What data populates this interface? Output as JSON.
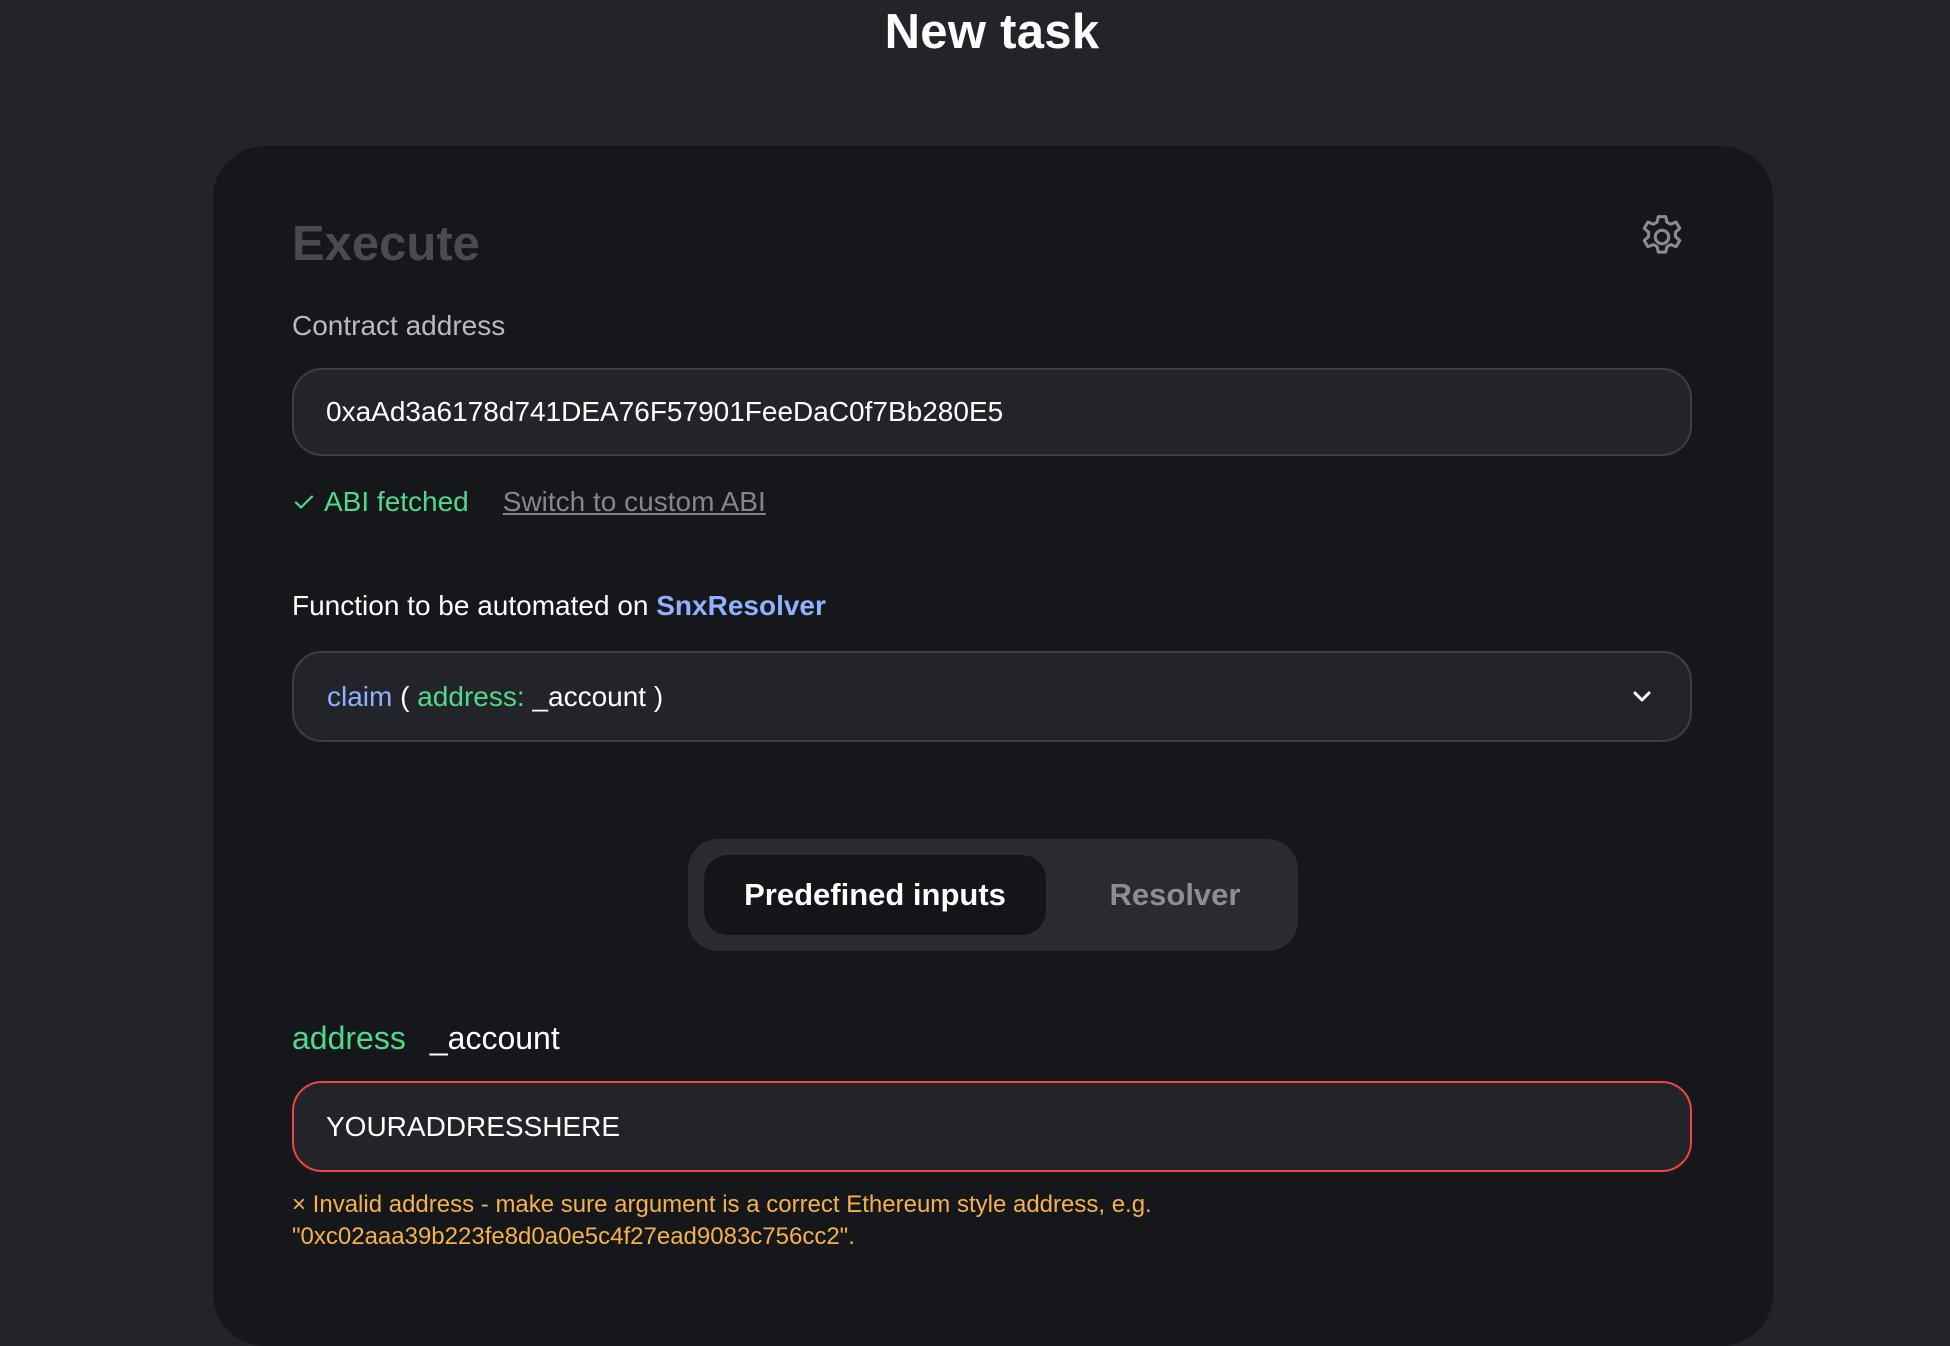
{
  "page": {
    "title": "New task"
  },
  "card": {
    "title": "Execute",
    "settings_icon": "gear-icon"
  },
  "contract": {
    "label": "Contract address",
    "value": "0xaAd3a6178d741DEA76F57901FeeDaC0f7Bb280E5"
  },
  "abi": {
    "status_icon": "check-icon",
    "status": "ABI fetched",
    "switch_link": "Switch to custom ABI"
  },
  "function_select": {
    "label_prefix": "Function to be automated on",
    "contract_name": "SnxResolver",
    "selected": {
      "name": "claim",
      "open_paren": "(",
      "param_type": "address:",
      "param_name": "_account",
      "close_paren": ")"
    },
    "dropdown_icon": "chevron-down-icon"
  },
  "mode_toggle": {
    "options": [
      {
        "label": "Predefined inputs",
        "active": true
      },
      {
        "label": "Resolver",
        "active": false
      }
    ]
  },
  "argument": {
    "type": "address",
    "name": "_account",
    "value": "YOURADDRESSHERE",
    "error_line1": "× Invalid address - make sure argument is a correct Ethereum style address, e.g.",
    "error_line2": "\"0xc02aaa39b223fe8d0a0e5c4f27ead9083c756cc2\"."
  },
  "colors": {
    "background": "#25222a",
    "card": "#16171b",
    "accent_blue": "#8fb1ff",
    "accent_green": "#4fd98a",
    "error_border": "#ef4444",
    "error_text": "#f5b14a"
  }
}
